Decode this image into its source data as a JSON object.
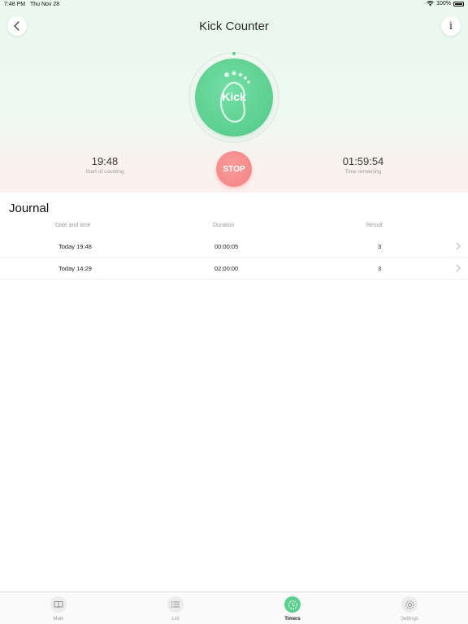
{
  "status_bar": {
    "time": "7:48 PM",
    "date": "Thu Nov 28",
    "battery": "100%"
  },
  "header": {
    "title": "Kick Counter"
  },
  "icons": {
    "back": "chevron-left-icon",
    "info": "info-icon",
    "foot": "footprint-icon",
    "row_chevron": "chevron-right-icon",
    "tab_main": "book-icon",
    "tab_list": "list-icon",
    "tab_timers": "timer-icon",
    "tab_settings": "gear-icon"
  },
  "kick": {
    "label": "Kick"
  },
  "counter": {
    "start_value": "19:48",
    "start_label": "Start of counting",
    "remaining_value": "01:59:54",
    "remaining_label": "Time remaining",
    "stop_label": "STOP"
  },
  "journal": {
    "title": "Journal",
    "columns": {
      "date": "Date and time",
      "duration": "Duration",
      "result": "Result"
    },
    "rows": [
      {
        "date": "Today 19:48",
        "duration": "00:00:05",
        "result": "3"
      },
      {
        "date": "Today 14:29",
        "duration": "02:00:00",
        "result": "3"
      }
    ]
  },
  "tabs": [
    {
      "label": "Main",
      "active": false
    },
    {
      "label": "List",
      "active": false
    },
    {
      "label": "Timers",
      "active": true
    },
    {
      "label": "Settings",
      "active": false
    }
  ],
  "colors": {
    "accent_green": "#5ccf8e",
    "stop_red": "#f48484",
    "header_top": "#eaf8f0",
    "header_bottom": "#fcefee"
  }
}
